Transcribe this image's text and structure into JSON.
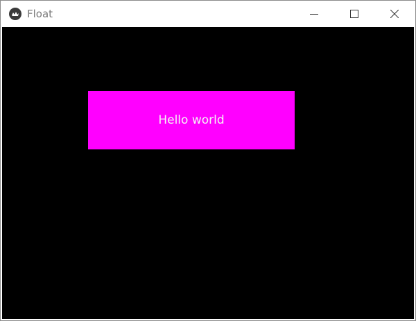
{
  "window": {
    "title": "Float",
    "app_icon": "kivy-logo-icon",
    "controls": {
      "minimize_icon": "minimize-icon",
      "maximize_icon": "maximize-icon",
      "close_icon": "close-icon"
    }
  },
  "content": {
    "background_color": "#000000",
    "label": {
      "text": "Hello world",
      "background_color": "#ff00ff",
      "text_color": "#f4f4f4"
    }
  }
}
